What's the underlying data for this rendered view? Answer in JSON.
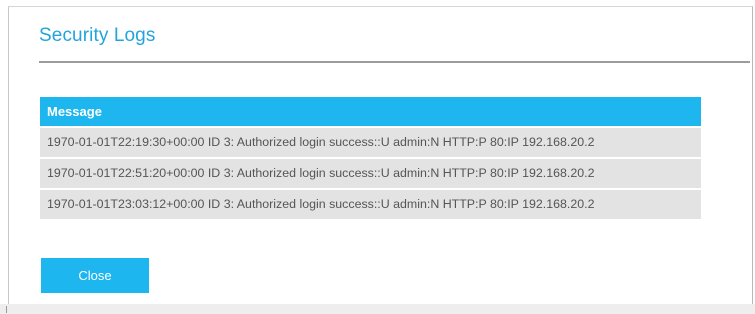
{
  "dialog": {
    "title": "Security Logs",
    "close_label": "Close"
  },
  "table": {
    "column_header": "Message",
    "rows": [
      "1970-01-01T22:19:30+00:00 ID 3: Authorized login success::U admin:N HTTP:P 80:IP 192.168.20.2",
      "1970-01-01T22:51:20+00:00 ID 3: Authorized login success::U admin:N HTTP:P 80:IP 192.168.20.2",
      "1970-01-01T23:03:12+00:00 ID 3: Authorized login success::U admin:N HTTP:P 80:IP 192.168.20.2"
    ]
  },
  "colors": {
    "accent": "#1db6ee",
    "title": "#23a4dd",
    "row_background": "#e3e3e3",
    "row_text": "#555555"
  }
}
